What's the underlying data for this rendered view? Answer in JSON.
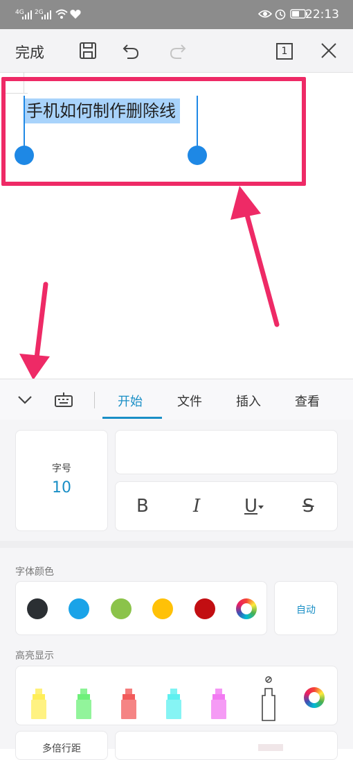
{
  "status_bar": {
    "signal1": "4G",
    "signal2": "2G",
    "time": "22:13"
  },
  "toolbar": {
    "done_label": "完成",
    "page_count": "1"
  },
  "document": {
    "selected_text": "手机如何制作删除线"
  },
  "tabs": {
    "items": [
      "开始",
      "文件",
      "插入",
      "查看"
    ],
    "active": "开始"
  },
  "font_size": {
    "label": "字号",
    "value": "10"
  },
  "format_buttons": {
    "bold": "B",
    "italic": "I",
    "underline": "U",
    "strike": "S"
  },
  "font_color": {
    "label": "字体颜色",
    "auto_label": "自动",
    "colors": [
      "#2b2f33",
      "#1aa3e8",
      "#8bc34a",
      "#ffc107",
      "#c20e12"
    ]
  },
  "highlight": {
    "label": "高亮显示",
    "colors": [
      "#ffee58",
      "#6ef07a",
      "#f25b5b",
      "#5ef0f0",
      "#f27af2"
    ]
  },
  "line_spacing": {
    "label": "多倍行距"
  }
}
